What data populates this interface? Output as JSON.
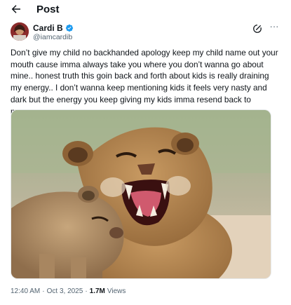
{
  "header": {
    "title": "Post"
  },
  "author": {
    "display_name": "Cardi B",
    "handle": "@iamcardib",
    "verified": true
  },
  "tweet": {
    "text": "Don’t give my child no backhanded apology keep my child name out your mouth cause imma always take you where you don’t wanna go about mine.. honest truth this goin back and forth about kids is really draining my energy.. I don’t wanna keep mentioning kids it feels very nasty and dark but the energy you keep giving my kids imma resend back to messenger"
  },
  "meta": {
    "time": "12:40 AM",
    "separator1": "·",
    "date": "Oct 3, 2025",
    "separator2": "·",
    "views_count": "1.7M",
    "views_label": "Views"
  },
  "icons": {
    "back": "arrow-left-icon",
    "verified": "verified-badge-icon",
    "grok": "grok-icon",
    "more": "more-icon"
  },
  "colors": {
    "text_primary": "#0f1419",
    "text_secondary": "#536471",
    "verified_blue": "#1d9bf0"
  }
}
